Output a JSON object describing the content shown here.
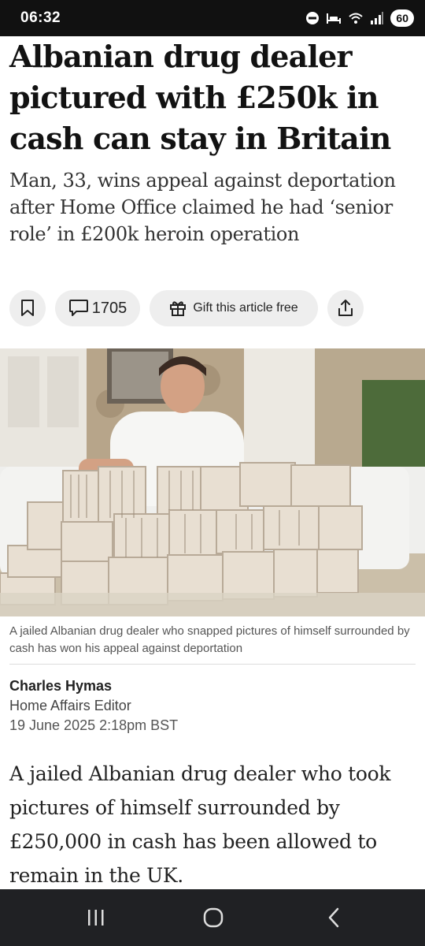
{
  "status_bar": {
    "time": "06:32",
    "battery": "60",
    "icons": [
      "do-not-disturb-icon",
      "sleep-icon",
      "wifi-icon",
      "signal-icon",
      "battery-icon"
    ]
  },
  "article": {
    "headline": "Albanian drug dealer pictured with £250k in cash can stay in Britain",
    "standfirst": "Man, 33, wins appeal against deportation after Home Office claimed he had ‘senior role’ in £200k heroin operation",
    "comment_count": "1705",
    "gift_label": "Gift this article free",
    "image_caption": "A jailed Albanian drug dealer who snapped pictures of himself surrounded by cash has won his appeal against deportation",
    "author_name": "Charles Hymas",
    "author_role": "Home Affairs Editor",
    "published": "19 June 2025 2:18pm BST",
    "body_first_paragraph": "A jailed Albanian drug dealer who took pictures of himself surrounded by £250,000 in cash has been allowed to remain in the UK."
  },
  "nav_bar": {
    "buttons": [
      "recent-apps",
      "home",
      "back"
    ]
  },
  "colors": {
    "status_bar_bg": "#111111",
    "nav_bar_bg": "#202124",
    "pill_bg": "#eeeeee",
    "headline": "#121212",
    "caption": "#555555"
  }
}
